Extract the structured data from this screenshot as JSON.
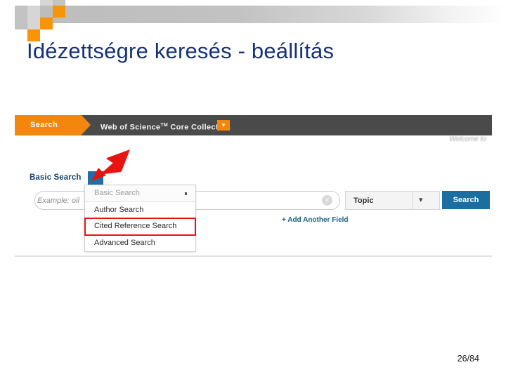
{
  "slide": {
    "title": "Idézettségre keresés - beállítás",
    "page_number": "26/84",
    "title_color": "#15317a"
  },
  "decor": {
    "orange": "#f79408",
    "gray": "#c3c3c3"
  },
  "screenshot": {
    "topbar": {
      "search_tab_label": "Search",
      "database_name": "Web of Science",
      "database_name_sup": "TM",
      "database_name_rest": " Core Collection",
      "database_chevron": "▾",
      "tab_color": "#f3870d",
      "bar_color": "#4a4a4a"
    },
    "welcome_text": "Welcome to",
    "search_mode": {
      "label": "Basic Search",
      "chevron": "▾",
      "dropdown_items": [
        {
          "label": "Basic Search",
          "state": "current"
        },
        {
          "label": "Author Search",
          "state": "normal"
        },
        {
          "label": "Cited Reference Search",
          "state": "highlighted"
        },
        {
          "label": "Advanced Search",
          "state": "normal"
        }
      ],
      "highlight_color": "#e8140f"
    },
    "search_row": {
      "input_value": "",
      "input_placeholder": "Example: oil",
      "clear_icon": "×",
      "field_selected": "Topic",
      "field_chevron": "▾",
      "search_button_label": "Search",
      "search_button_color": "#1a6ea0"
    },
    "add_another_field_label": "+ Add Another Field"
  },
  "annotation": {
    "arrow_color": "#e8140f",
    "arrow_points_at": "search-mode-chevron-button"
  }
}
